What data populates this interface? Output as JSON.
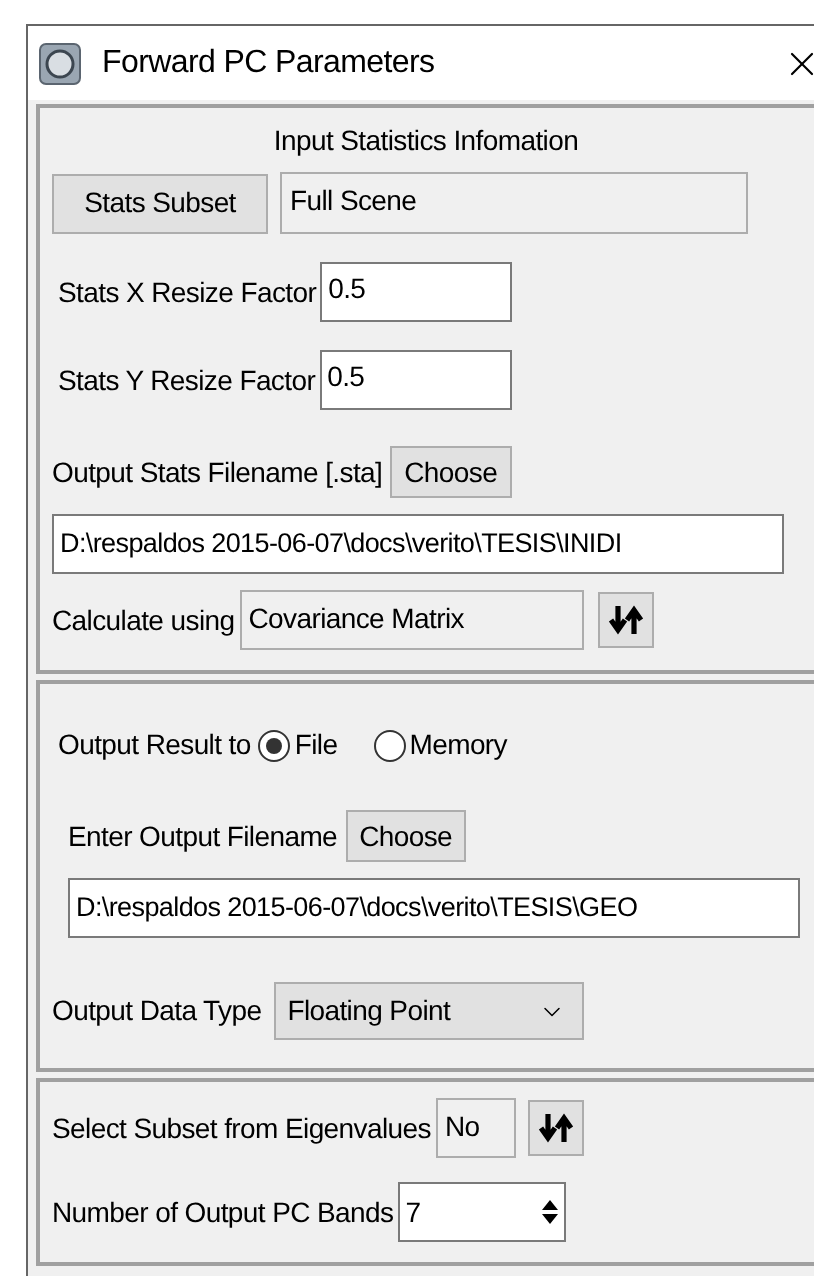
{
  "window": {
    "title": "Forward PC Parameters"
  },
  "input_statistics": {
    "heading": "Input Statistics Infomation",
    "stats_subset_button": "Stats Subset",
    "stats_subset_value": "Full Scene",
    "x_resize": {
      "label": "Stats X Resize Factor",
      "value": "0.5"
    },
    "y_resize": {
      "label": "Stats Y Resize Factor",
      "value": "0.5"
    },
    "output_stats": {
      "label": "Output Stats Filename [.sta]",
      "button": "Choose",
      "path": "D:\\respaldos 2015-06-07\\docs\\verito\\TESIS\\INIDI"
    },
    "calculate_using": {
      "label": "Calculate using",
      "value": "Covariance Matrix"
    }
  },
  "output": {
    "label": "Output Result to",
    "options": [
      {
        "label": "File",
        "selected": true
      },
      {
        "label": "Memory",
        "selected": false
      }
    ],
    "filename": {
      "label": "Enter Output Filename",
      "button": "Choose",
      "path": "D:\\respaldos 2015-06-07\\docs\\verito\\TESIS\\GEO"
    },
    "data_type": {
      "label": "Output Data Type",
      "value": "Floating Point"
    }
  },
  "pc_bands": {
    "subset": {
      "label": "Select Subset from Eigenvalues",
      "value": "No"
    },
    "bands": {
      "label": "Number of Output PC Bands",
      "value": "7"
    }
  }
}
